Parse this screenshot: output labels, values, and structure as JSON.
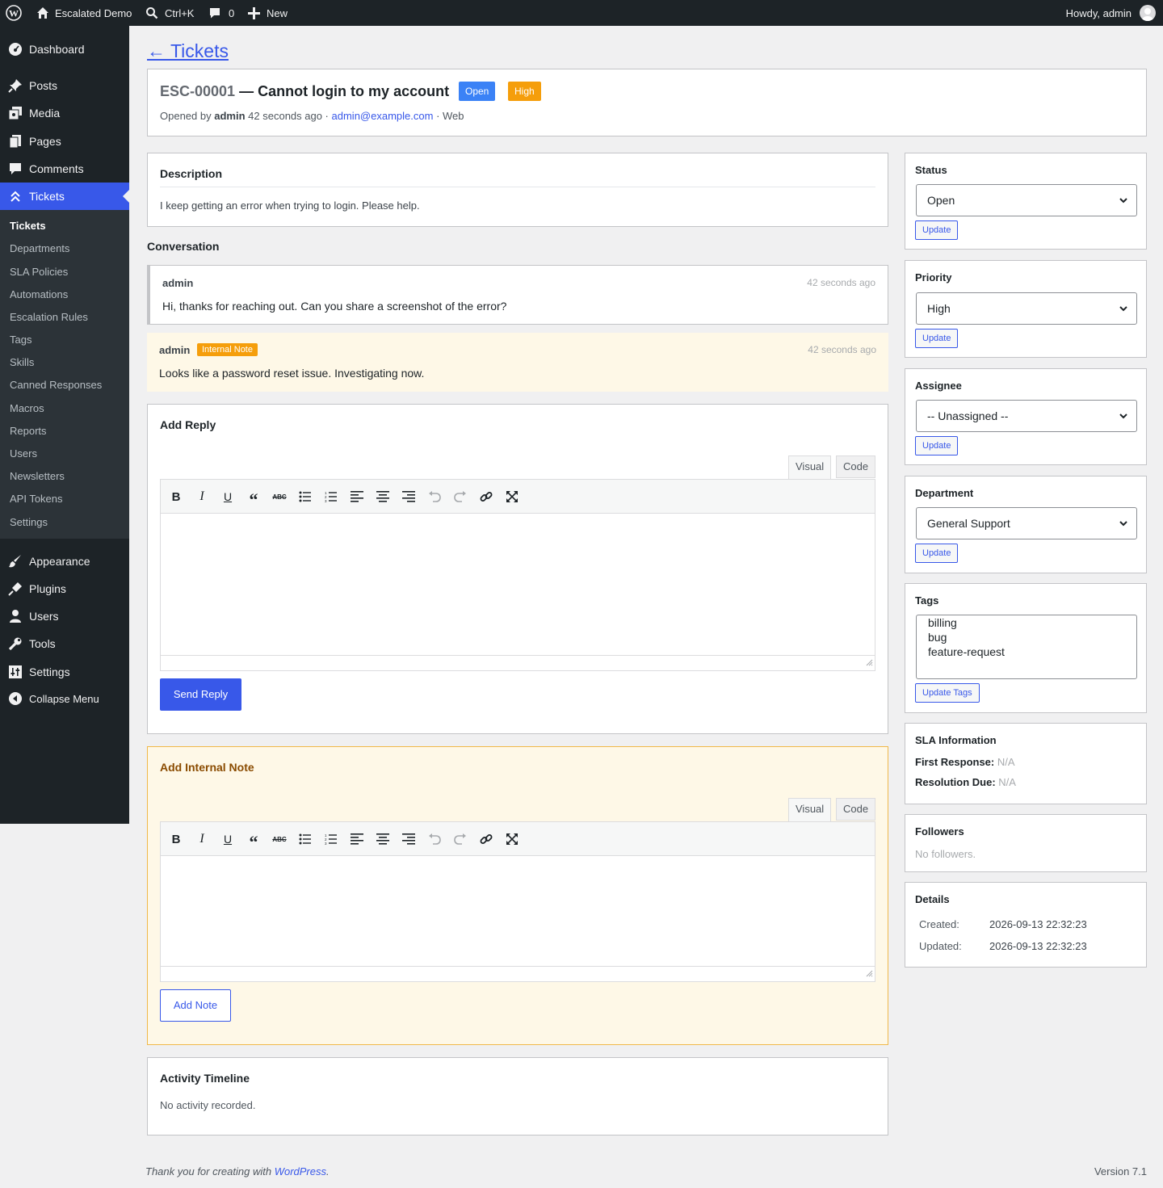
{
  "adminbar": {
    "site_name": "Escalated Demo",
    "search_shortcut": "Ctrl+K",
    "comments_count": "0",
    "new_label": "New",
    "greeting": "Howdy, admin"
  },
  "sidebar": {
    "menu": [
      {
        "label": "Dashboard",
        "icon": "dashboard-icon"
      },
      {
        "label": "Posts",
        "icon": "pin-icon"
      },
      {
        "label": "Media",
        "icon": "media-icon"
      },
      {
        "label": "Pages",
        "icon": "pages-icon"
      },
      {
        "label": "Comments",
        "icon": "comment-icon"
      },
      {
        "label": "Tickets",
        "icon": "chevrons-up-icon"
      }
    ],
    "submenu": [
      "Tickets",
      "Departments",
      "SLA Policies",
      "Automations",
      "Escalation Rules",
      "Tags",
      "Skills",
      "Canned Responses",
      "Macros",
      "Reports",
      "Users",
      "Newsletters",
      "API Tokens",
      "Settings"
    ],
    "menu_lower": [
      {
        "label": "Appearance",
        "icon": "brush-icon"
      },
      {
        "label": "Plugins",
        "icon": "plug-icon"
      },
      {
        "label": "Users",
        "icon": "user-icon"
      },
      {
        "label": "Tools",
        "icon": "wrench-icon"
      },
      {
        "label": "Settings",
        "icon": "sliders-icon"
      }
    ],
    "collapse_label": "Collapse Menu"
  },
  "back_link": "← Tickets",
  "ticket": {
    "ref": "ESC-00001",
    "title": "— Cannot login to my account",
    "status_badge": "Open",
    "priority_badge": "High",
    "meta_prefix": "Opened by",
    "meta_user": "admin",
    "meta_time": "42 seconds ago ·",
    "meta_email": "admin@example.com",
    "meta_channel": "· Web",
    "colors": {
      "status": "#3b82f6",
      "priority": "#f59e0b",
      "accent": "#3858e9"
    }
  },
  "description": {
    "heading": "Description",
    "body": "I keep getting an error when trying to login. Please help."
  },
  "conversation": {
    "heading": "Conversation",
    "messages": [
      {
        "author": "admin",
        "time": "42 seconds ago",
        "body": "Hi, thanks for reaching out. Can you share a screenshot of the error?"
      },
      {
        "author": "admin",
        "tag": "Internal Note",
        "time": "42 seconds ago",
        "body": "Looks like a password reset issue. Investigating now."
      }
    ]
  },
  "reply": {
    "heading": "Add Reply",
    "tab_visual": "Visual",
    "tab_code": "Code",
    "submit": "Send Reply"
  },
  "note": {
    "heading": "Add Internal Note",
    "tab_visual": "Visual",
    "tab_code": "Code",
    "submit": "Add Note"
  },
  "activity": {
    "heading": "Activity Timeline",
    "empty": "No activity recorded."
  },
  "side": {
    "status": {
      "label": "Status",
      "value": "Open",
      "button": "Update"
    },
    "priority": {
      "label": "Priority",
      "value": "High",
      "button": "Update"
    },
    "assignee": {
      "label": "Assignee",
      "value": "-- Unassigned --",
      "button": "Update"
    },
    "department": {
      "label": "Department",
      "value": "General Support",
      "button": "Update"
    },
    "tags": {
      "label": "Tags",
      "options": [
        "billing",
        "bug",
        "feature-request"
      ],
      "button": "Update Tags"
    },
    "sla": {
      "label": "SLA Information",
      "first_response_label": "First Response:",
      "first_response_value": "N/A",
      "resolution_label": "Resolution Due:",
      "resolution_value": "N/A"
    },
    "followers": {
      "label": "Followers",
      "empty": "No followers."
    },
    "details": {
      "label": "Details",
      "created_label": "Created:",
      "created_value": "2026-09-13 22:32:23",
      "updated_label": "Updated:",
      "updated_value": "2026-09-13 22:32:23"
    }
  },
  "footer": {
    "thanks_prefix": "Thank you for creating with",
    "thanks_link": "WordPress",
    "thanks_suffix": ".",
    "version": "Version 7.1"
  }
}
